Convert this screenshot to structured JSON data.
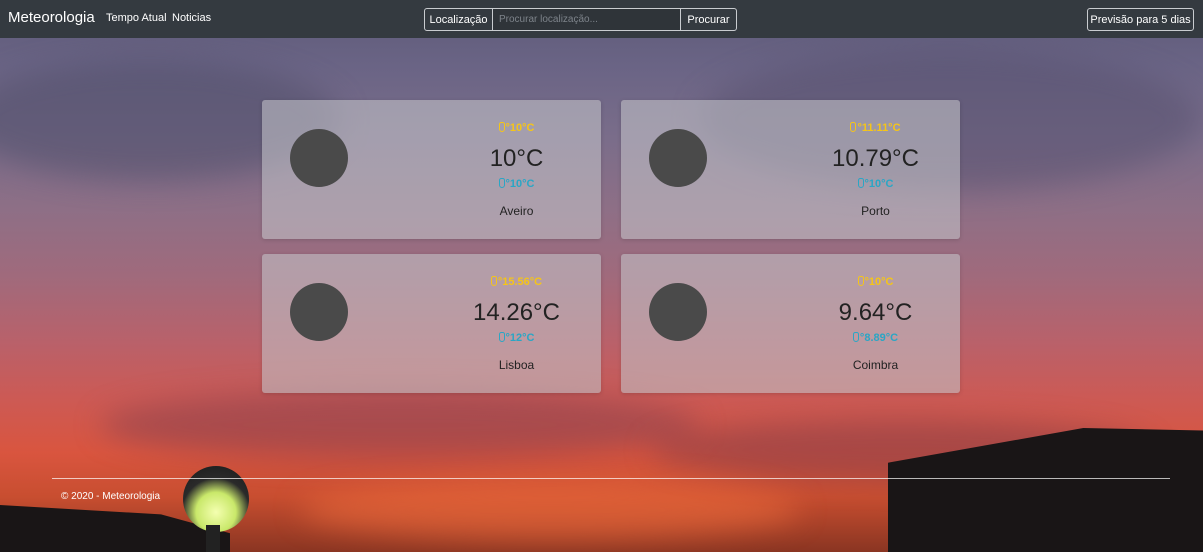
{
  "navbar": {
    "brand": "Meteorologia",
    "links": [
      "Tempo Atual",
      "Noticias"
    ],
    "search_label": "Localização",
    "search_placeholder": "Procurar localização...",
    "search_value": "",
    "search_button": "Procurar",
    "forecast_button": "Previsão para 5 dias"
  },
  "cards": [
    {
      "max": "°10°C",
      "temp": "10°C",
      "min": "°10°C",
      "city": "Aveiro",
      "icon": "weather-icon"
    },
    {
      "max": "°11.11°C",
      "temp": "10.79°C",
      "min": "°10°C",
      "city": "Porto",
      "icon": "weather-icon"
    },
    {
      "max": "°15.56°C",
      "temp": "14.26°C",
      "min": "°12°C",
      "city": "Lisboa",
      "icon": "weather-icon"
    },
    {
      "max": "°10°C",
      "temp": "9.64°C",
      "min": "°8.89°C",
      "city": "Coimbra",
      "icon": "weather-icon"
    }
  ],
  "footer": {
    "text": "© 2020 - Meteorologia"
  },
  "colors": {
    "navbar": "#343a40",
    "max_temp": "#f5c518",
    "min_temp": "#2aa6c5"
  }
}
